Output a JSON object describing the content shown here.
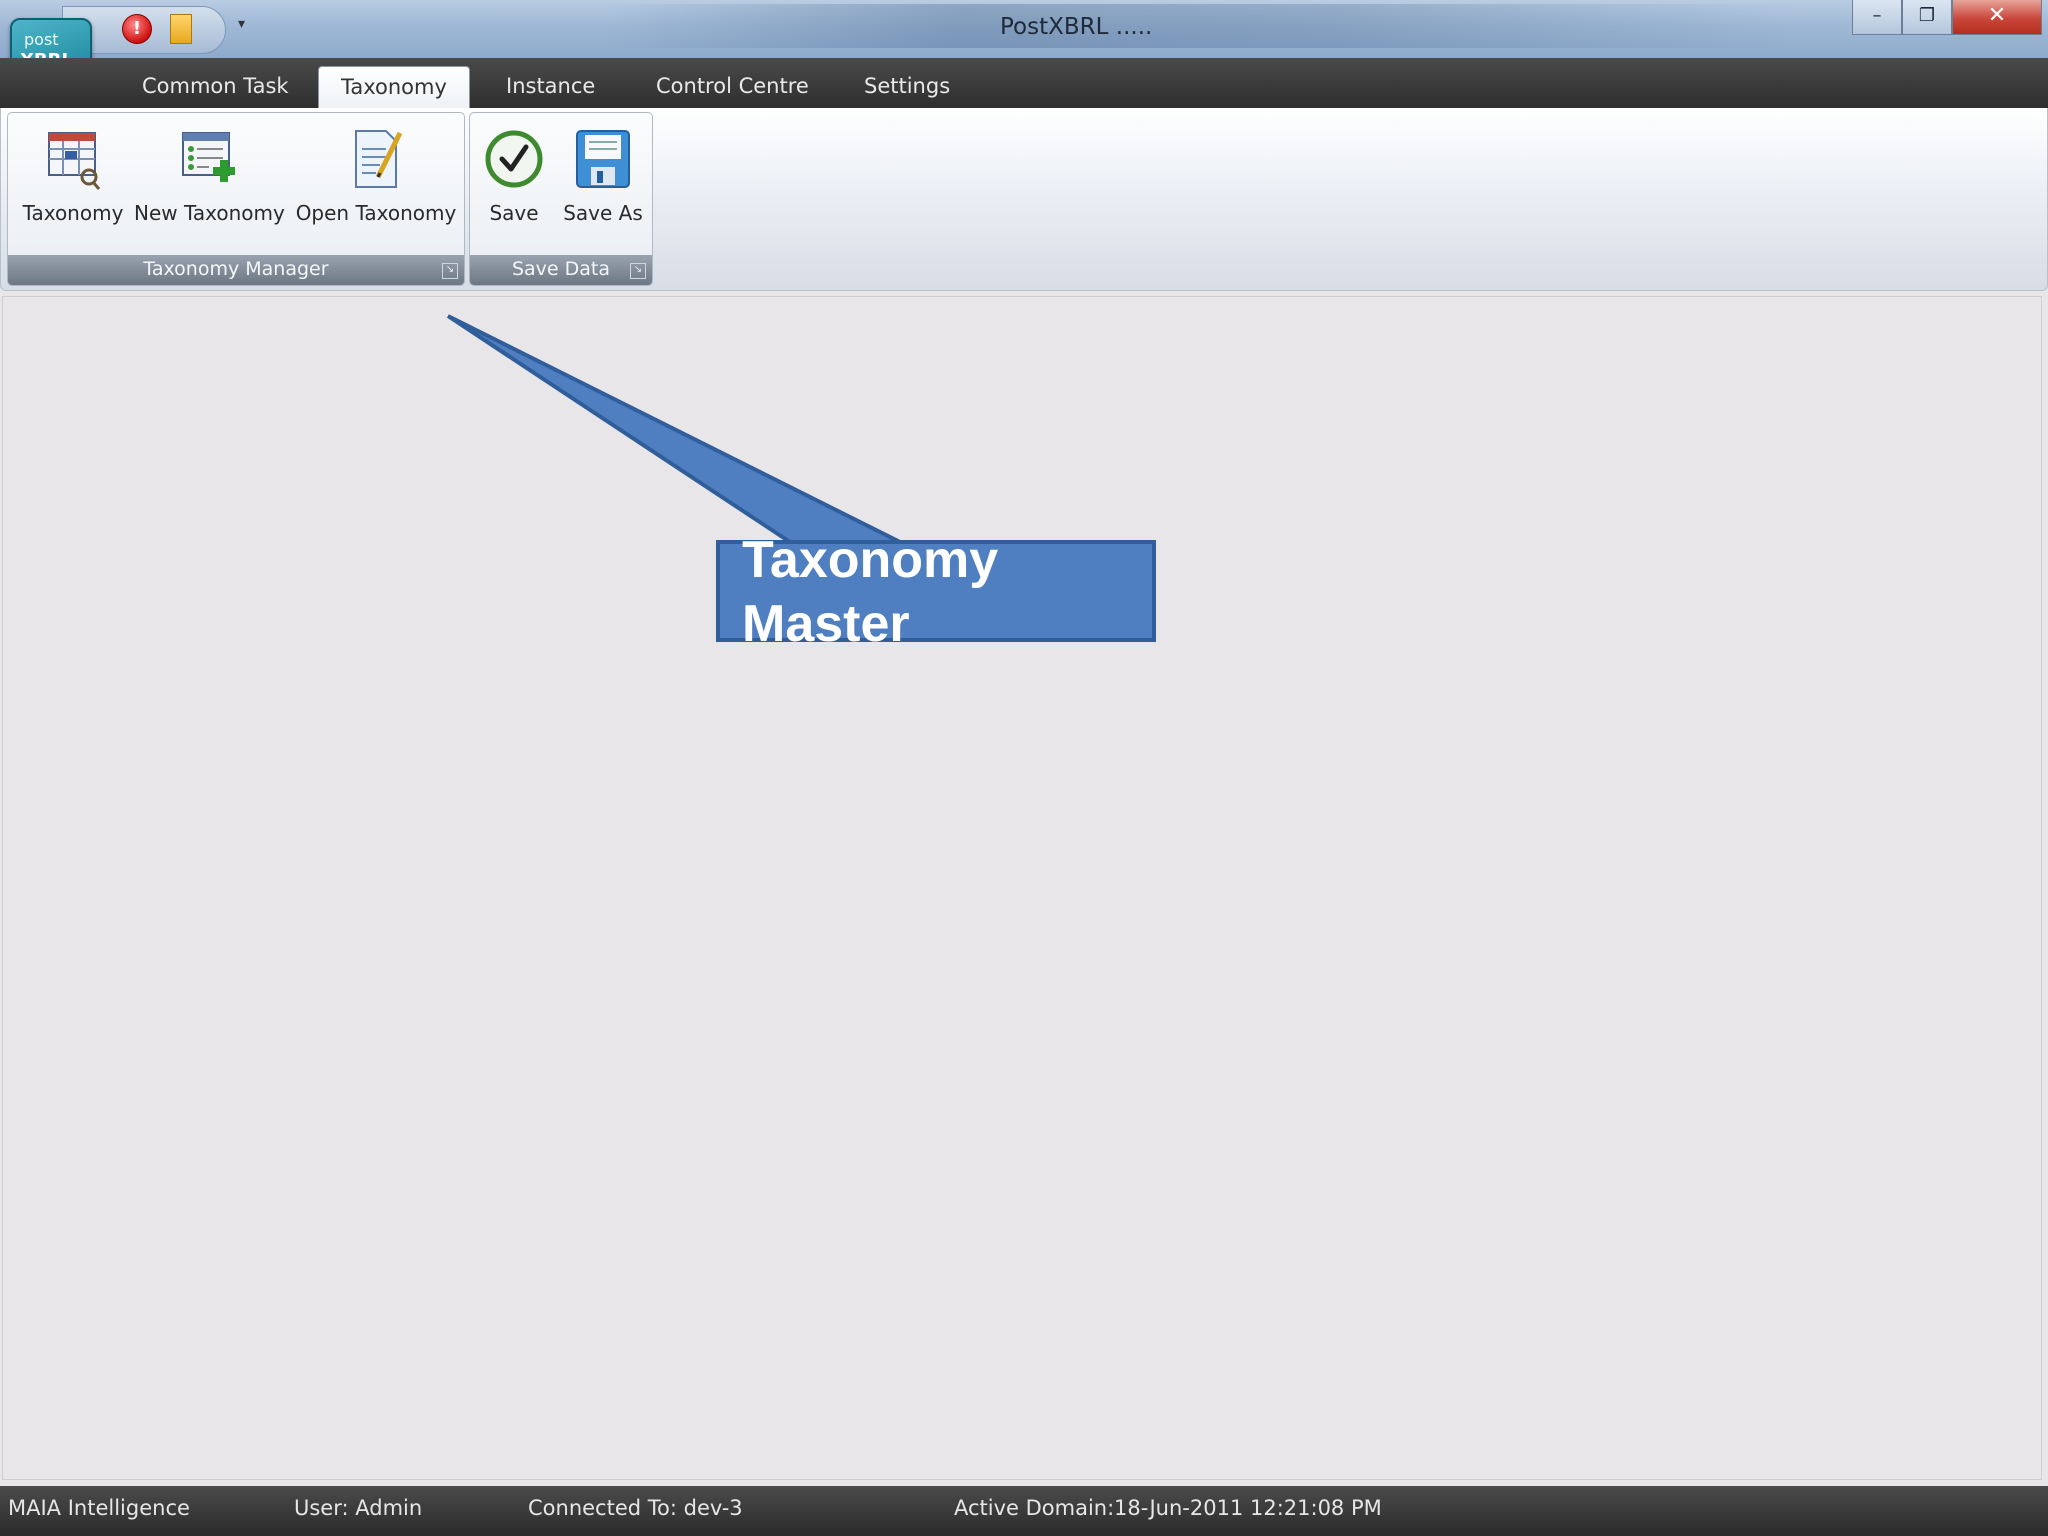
{
  "window": {
    "title": "PostXBRL .....",
    "logo_line1": "post",
    "logo_line2": "XBRL",
    "minimize_glyph": "–",
    "restore_glyph": "❐",
    "close_glyph": "✕"
  },
  "quick_access": {
    "stop_glyph": "!",
    "dropdown_glyph": "▾"
  },
  "tabs": [
    {
      "label": "Common Task"
    },
    {
      "label": "Taxonomy"
    },
    {
      "label": "Instance"
    },
    {
      "label": "Control Centre"
    },
    {
      "label": "Settings"
    }
  ],
  "ribbon": {
    "groups": [
      {
        "label": "Taxonomy Manager",
        "buttons": [
          {
            "label": "Taxonomy",
            "icon": "taxonomy-grid-icon"
          },
          {
            "label": "New Taxonomy",
            "icon": "new-taxonomy-icon"
          },
          {
            "label": "Open Taxonomy",
            "icon": "open-taxonomy-icon"
          }
        ]
      },
      {
        "label": "Save Data",
        "buttons": [
          {
            "label": "Save",
            "icon": "checkmark-icon"
          },
          {
            "label": "Save As",
            "icon": "floppy-disk-icon"
          }
        ]
      }
    ],
    "launcher_glyph": "↘"
  },
  "callout": {
    "text": "Taxonomy Master",
    "fill": "#4f7fc0",
    "stroke": "#2f5e9a"
  },
  "statusbar": {
    "company": "MAIA Intelligence",
    "user": "User: Admin",
    "connection": "Connected To: dev-3",
    "domain": "Active Domain:",
    "datetime": "18-Jun-2011 12:21:08 PM"
  }
}
